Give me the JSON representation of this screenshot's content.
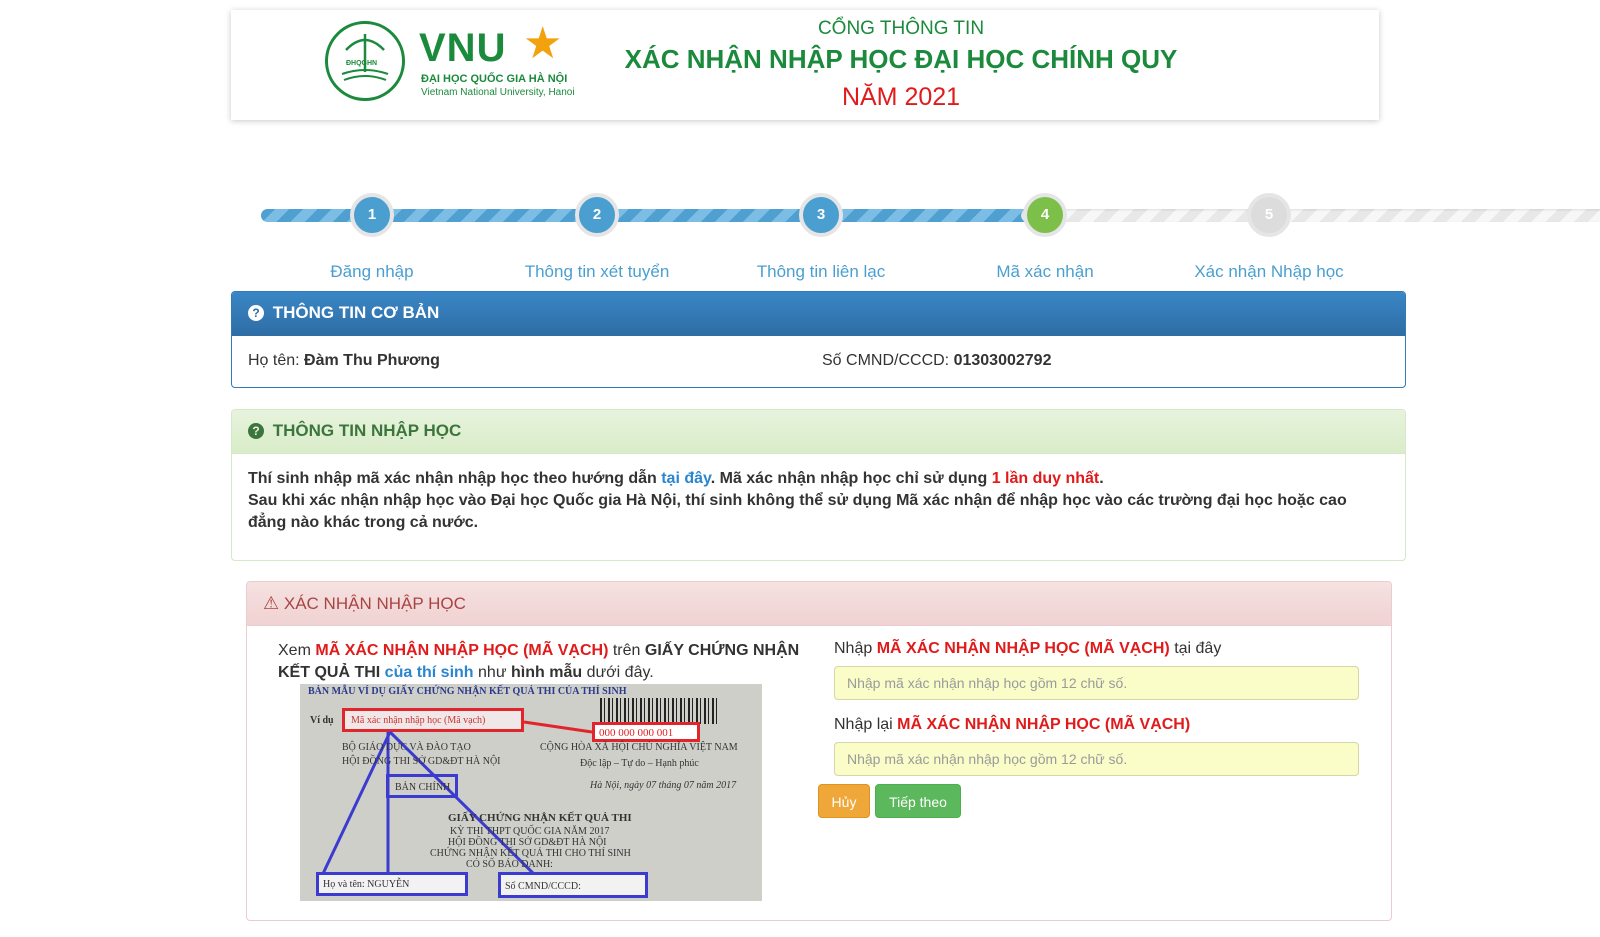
{
  "header": {
    "logo_vnu": "VNU",
    "logo_small": "ĐHQGHN",
    "uni_name_vn": "ĐẠI HỌC QUỐC GIA HÀ NỘI",
    "uni_name_en": "Vietnam National University, Hanoi",
    "portal": "CỔNG THÔNG TIN",
    "title": "XÁC NHẬN NHẬP HỌC ĐẠI HỌC CHÍNH QUY",
    "year": "NĂM 2021"
  },
  "steps": [
    {
      "num": "1",
      "label": "Đăng nhập",
      "state": "done"
    },
    {
      "num": "2",
      "label": "Thông tin xét tuyển",
      "state": "done"
    },
    {
      "num": "3",
      "label": "Thông tin liên lạc",
      "state": "done"
    },
    {
      "num": "4",
      "label": "Mã xác nhận",
      "state": "current"
    },
    {
      "num": "5",
      "label": "Xác nhận Nhập học",
      "state": "todo"
    }
  ],
  "basic_info": {
    "heading": "THÔNG TIN CƠ BẢN",
    "name_label": "Họ tên:",
    "name_value": "Đàm Thu Phương",
    "id_label": "Số CMND/CCCD:",
    "id_value": "01303002792"
  },
  "admission_info": {
    "heading": "THÔNG TIN NHẬP HỌC",
    "line1_a": "Thí sinh nhập mã xác nhận nhập học theo hướng dẫn",
    "line1_link": "tại đây",
    "line1_b": ". Mã xác nhận nhập học chỉ sử dụng",
    "line1_red": "1 lần duy nhất",
    "line1_end": ".",
    "line2": "Sau khi xác nhận nhập học vào Đại học Quốc gia Hà Nội, thí sinh không thể sử dụng Mã xác nhận để nhập học vào các trường đại học hoặc cao đẳng nào khác trong cả nước."
  },
  "confirm": {
    "heading": "XÁC NHẬN NHẬP HỌC",
    "left_view": "Xem",
    "left_code": "MÃ XÁC NHẬN NHẬP HỌC (MÃ VẠCH)",
    "left_on": "trên",
    "left_cert": "GIẤY CHỨNG NHẬN KẾT QUẢ THI",
    "left_of": "của thí sinh",
    "left_like": "như",
    "left_sample": "hình mẫu",
    "left_below": "dưới đây.",
    "enter_label_a": "Nhập",
    "enter_label_code": "MÃ XÁC NHẬN NHẬP HỌC (MÃ VẠCH)",
    "enter_label_b": "tại đây",
    "reenter_label_a": "Nhập lại",
    "reenter_label_code": "MÃ XÁC NHẬN NHẬP HỌC (MÃ VẠCH)",
    "input_placeholder": "Nhập mã xác nhận nhập học gồm 12 chữ số.",
    "cancel_label": "Hủy",
    "next_label": "Tiếp theo"
  },
  "sample_image": {
    "top_title": "BẢN MẪU VÍ DỤ GIẤY CHỨNG NHẬN KẾT QUẢ THI CỦA THÍ SINH",
    "vi_du": "Ví dụ",
    "code_box": "Mã xác nhận nhập học (Mã vạch)",
    "code_number": "000 000 000 001",
    "ministry": "BỘ GIÁO DỤC VÀ ĐÀO TẠO",
    "council": "HỘI ĐỒNG THI SỞ GD&ĐT HÀ NỘI",
    "republic": "CỘNG HÒA XÃ HỘI CHỦ NGHĨA VIỆT NAM",
    "motto": "Độc lập – Tự do – Hạnh phúc",
    "date": "Hà Nội, ngày 07 tháng 07 năm 2017",
    "original": "BẢN CHÍNH",
    "cert_title": "GIẤY CHỨNG NHẬN KẾT QUẢ THI",
    "cert_l2": "KỲ THI THPT QUỐC GIA NĂM 2017",
    "cert_l3": "HỘI ĐỒNG THI SỞ GD&ĐT HÀ NỘI",
    "cert_l4": "CHỨNG NHẬN KẾT QUẢ THI CHO THÍ SINH",
    "cert_l5": "CÓ SỐ BÁO DANH:",
    "name_box": "Họ và tên: NGUYỄN",
    "id_box": "Số CMND/CCCD:"
  }
}
